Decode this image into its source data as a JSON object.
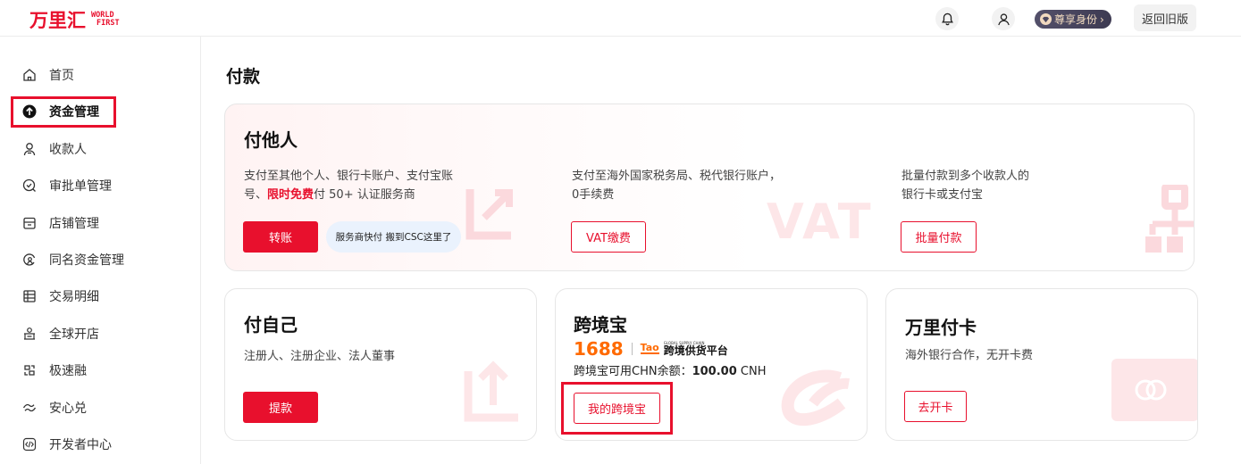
{
  "header": {
    "logo_cn": "万里汇",
    "logo_en_line1": "WORLD",
    "logo_en_line2": "FIRST",
    "vip_label": "尊享身份",
    "vip_arrow": "›",
    "back_old_label": "返回旧版"
  },
  "sidebar": {
    "items": [
      {
        "label": "首页",
        "icon": "home-icon"
      },
      {
        "label": "资金管理",
        "icon": "arrow-up-circle-icon"
      },
      {
        "label": "收款人",
        "icon": "payee-icon"
      },
      {
        "label": "审批单管理",
        "icon": "approval-icon"
      },
      {
        "label": "店铺管理",
        "icon": "store-icon"
      },
      {
        "label": "同名资金管理",
        "icon": "same-name-icon"
      },
      {
        "label": "交易明细",
        "icon": "list-icon"
      },
      {
        "label": "全球开店",
        "icon": "global-store-icon"
      },
      {
        "label": "极速融",
        "icon": "fast-finance-icon"
      },
      {
        "label": "安心兑",
        "icon": "exchange-icon"
      },
      {
        "label": "开发者中心",
        "icon": "code-icon"
      }
    ]
  },
  "main": {
    "title": "付款",
    "pay_others": {
      "title": "付他人",
      "col1_line1": "支付至其他个人、银行卡账户、支付宝账",
      "col1_line2_prefix": "号、",
      "col1_line2_highlight": "限时免费",
      "col1_line2_suffix": "付 50+ 认证服务商",
      "transfer_button": "转账",
      "pill_text": "服务商快付 搬到CSC这里了",
      "col2_line1": "支付至海外国家税务局、税代银行账户，",
      "col2_line2": "0手续费",
      "vat_button": "VAT缴费",
      "col3_line1": "批量付款到多个收款人的",
      "col3_line2": "银行卡或支付宝",
      "batch_button": "批量付款",
      "vat_watermark": "VAT"
    },
    "pay_self": {
      "title": "付自己",
      "desc": "注册人、注册企业、法人董事",
      "withdraw_button": "提款"
    },
    "kjb": {
      "title": "跨境宝",
      "logo_1688": "1688",
      "tao_mark": "Tao",
      "tao_small": "GLOBAL SUPPLY CHAIN",
      "tao_big": "跨境供货平台",
      "balance_label": "跨境宝可用CHN余额：",
      "balance_value": "100.00",
      "balance_currency": "CNH",
      "my_button": "我的跨境宝"
    },
    "wanli_card": {
      "title": "万里付卡",
      "desc": "海外银行合作，无开卡费",
      "open_button": "去开卡"
    }
  },
  "colors": {
    "brand_red": "#e8102d",
    "orange_1688": "#ff6a00",
    "pill_bg": "#eaf2fd"
  }
}
